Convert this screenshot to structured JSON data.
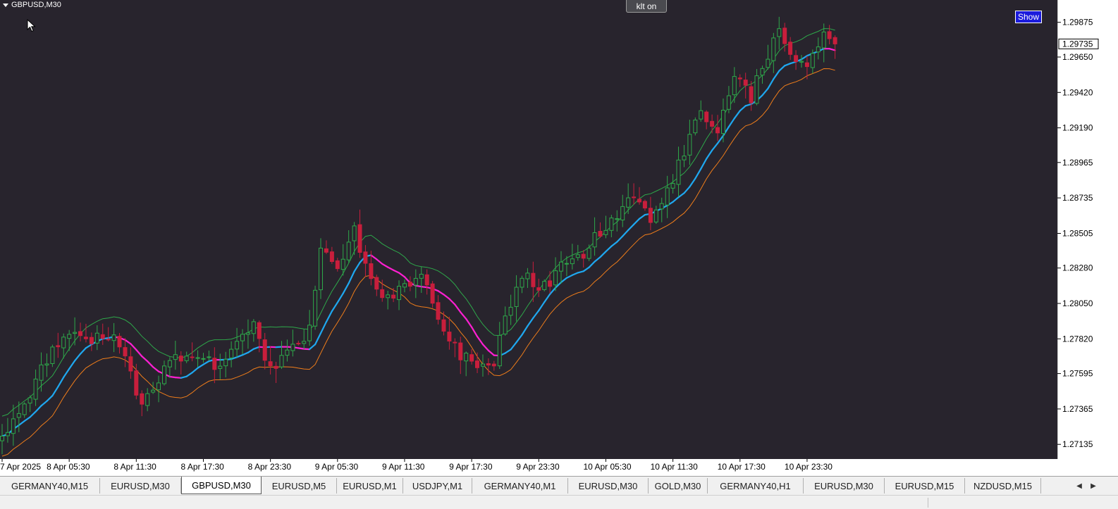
{
  "window": {
    "symbol_label": "GBPUSD,M30"
  },
  "buttons": {
    "klt": "klt on",
    "show": "Show"
  },
  "chart_data": {
    "type": "candlestick",
    "ylim": [
      1.2704,
      1.3002
    ],
    "y_ticks": [
      {
        "value": 1.29875,
        "label": "1.29875"
      },
      {
        "value": 1.2965,
        "label": "1.29650"
      },
      {
        "value": 1.2942,
        "label": "1.29420"
      },
      {
        "value": 1.2919,
        "label": "1.29190"
      },
      {
        "value": 1.28965,
        "label": "1.28965"
      },
      {
        "value": 1.28735,
        "label": "1.28735"
      },
      {
        "value": 1.28505,
        "label": "1.28505"
      },
      {
        "value": 1.2828,
        "label": "1.28280"
      },
      {
        "value": 1.2805,
        "label": "1.28050"
      },
      {
        "value": 1.2782,
        "label": "1.27820"
      },
      {
        "value": 1.27595,
        "label": "1.27595"
      },
      {
        "value": 1.27365,
        "label": "1.27365"
      },
      {
        "value": 1.27135,
        "label": "1.27135"
      }
    ],
    "current_price": {
      "value": 1.29735,
      "label": "1.29735"
    },
    "x_labels": [
      {
        "bar": 0,
        "label": "7 Apr 2025"
      },
      {
        "bar": 12,
        "label": "8 Apr 05:30"
      },
      {
        "bar": 24,
        "label": "8 Apr 11:30"
      },
      {
        "bar": 36,
        "label": "8 Apr 17:30"
      },
      {
        "bar": 48,
        "label": "8 Apr 23:30"
      },
      {
        "bar": 60,
        "label": "9 Apr 05:30"
      },
      {
        "bar": 72,
        "label": "9 Apr 11:30"
      },
      {
        "bar": 84,
        "label": "9 Apr 17:30"
      },
      {
        "bar": 96,
        "label": "9 Apr 23:30"
      },
      {
        "bar": 108,
        "label": "10 Apr 05:30"
      },
      {
        "bar": 120,
        "label": "10 Apr 11:30"
      },
      {
        "bar": 132,
        "label": "10 Apr 17:30"
      },
      {
        "bar": 144,
        "label": "10 Apr 23:30"
      }
    ],
    "bar_count": 150,
    "path_points": [
      [
        0,
        1.2716
      ],
      [
        4,
        1.2739
      ],
      [
        6,
        1.2756
      ],
      [
        9,
        1.2777
      ],
      [
        12,
        1.2786
      ],
      [
        16,
        1.2781
      ],
      [
        20,
        1.2787
      ],
      [
        22,
        1.2768
      ],
      [
        25,
        1.2736
      ],
      [
        29,
        1.2761
      ],
      [
        32,
        1.2772
      ],
      [
        36,
        1.2769
      ],
      [
        39,
        1.2761
      ],
      [
        42,
        1.2783
      ],
      [
        45,
        1.2789
      ],
      [
        48,
        1.2764
      ],
      [
        51,
        1.2772
      ],
      [
        55,
        1.2787
      ],
      [
        57,
        1.2842
      ],
      [
        60,
        1.2828
      ],
      [
        63,
        1.2851
      ],
      [
        66,
        1.2821
      ],
      [
        69,
        1.2808
      ],
      [
        72,
        1.2818
      ],
      [
        75,
        1.2822
      ],
      [
        78,
        1.2798
      ],
      [
        81,
        1.2776
      ],
      [
        84,
        1.2766
      ],
      [
        88,
        1.2768
      ],
      [
        90,
        1.2793
      ],
      [
        93,
        1.2824
      ],
      [
        97,
        1.2815
      ],
      [
        100,
        1.2829
      ],
      [
        104,
        1.2838
      ],
      [
        108,
        1.2855
      ],
      [
        112,
        1.2874
      ],
      [
        116,
        1.2859
      ],
      [
        120,
        1.2885
      ],
      [
        123,
        1.2915
      ],
      [
        125,
        1.2932
      ],
      [
        128,
        1.2915
      ],
      [
        131,
        1.2952
      ],
      [
        134,
        1.2939
      ],
      [
        138,
        1.2977
      ],
      [
        139,
        1.2984
      ],
      [
        142,
        1.2958
      ],
      [
        145,
        1.2964
      ],
      [
        147,
        1.2981
      ],
      [
        149,
        1.29735
      ]
    ],
    "series": [
      {
        "color": "#f07d1a",
        "role": "lower-band",
        "offset": -0.0013,
        "period": 10
      },
      {
        "color": "#1fa8f0",
        "alt_color": "#ff1fd2",
        "role": "center-line",
        "offset": 0.0,
        "period": 10
      },
      {
        "color": "#2ea84a",
        "role": "upper-band",
        "offset": 0.0013,
        "period": 10
      }
    ],
    "candle_colors": {
      "up": "#2ea84a",
      "down": "#c81e3c",
      "bull_body": "#28242d",
      "bear_body": "#c81e3c"
    }
  },
  "tabs": [
    {
      "label": "GERMANY40,M15"
    },
    {
      "label": "EURUSD,M30"
    },
    {
      "label": "GBPUSD,M30",
      "active": true
    },
    {
      "label": "EURUSD,M5"
    },
    {
      "label": "EURUSD,M1"
    },
    {
      "label": "USDJPY,M1"
    },
    {
      "label": "GERMANY40,M1"
    },
    {
      "label": "EURUSD,M30"
    },
    {
      "label": "GOLD,M30"
    },
    {
      "label": "GERMANY40,H1"
    },
    {
      "label": "EURUSD,M30"
    },
    {
      "label": "EURUSD,M15"
    },
    {
      "label": "NZDUSD,M15"
    }
  ],
  "tab_scroll": {
    "left": "◀",
    "right": "▶"
  },
  "icons": {
    "cursor": "mouse-pointer-icon",
    "menu": "triangle-down-icon"
  }
}
